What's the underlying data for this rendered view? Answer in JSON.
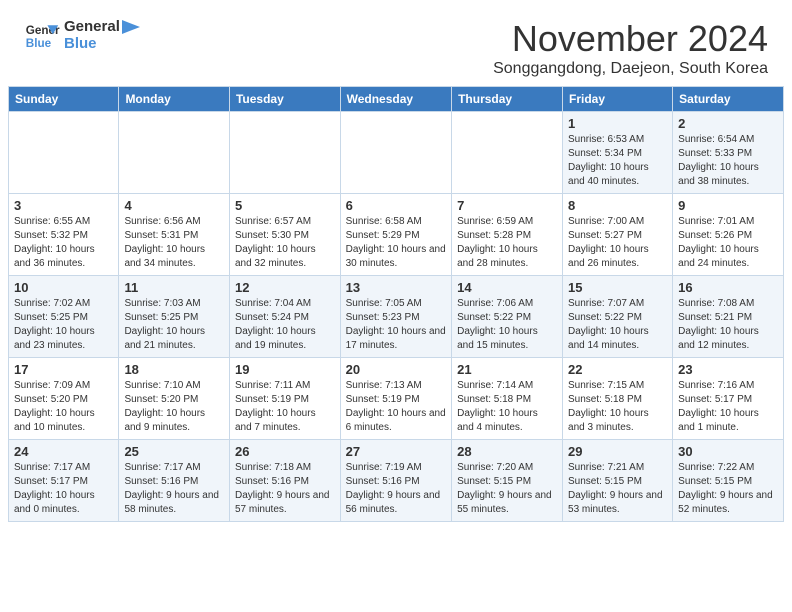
{
  "header": {
    "logo_line1": "General",
    "logo_line2": "Blue",
    "month": "November 2024",
    "location": "Songgangdong, Daejeon, South Korea"
  },
  "weekdays": [
    "Sunday",
    "Monday",
    "Tuesday",
    "Wednesday",
    "Thursday",
    "Friday",
    "Saturday"
  ],
  "weeks": [
    [
      {
        "day": "",
        "info": ""
      },
      {
        "day": "",
        "info": ""
      },
      {
        "day": "",
        "info": ""
      },
      {
        "day": "",
        "info": ""
      },
      {
        "day": "",
        "info": ""
      },
      {
        "day": "1",
        "info": "Sunrise: 6:53 AM\nSunset: 5:34 PM\nDaylight: 10 hours and 40 minutes."
      },
      {
        "day": "2",
        "info": "Sunrise: 6:54 AM\nSunset: 5:33 PM\nDaylight: 10 hours and 38 minutes."
      }
    ],
    [
      {
        "day": "3",
        "info": "Sunrise: 6:55 AM\nSunset: 5:32 PM\nDaylight: 10 hours and 36 minutes."
      },
      {
        "day": "4",
        "info": "Sunrise: 6:56 AM\nSunset: 5:31 PM\nDaylight: 10 hours and 34 minutes."
      },
      {
        "day": "5",
        "info": "Sunrise: 6:57 AM\nSunset: 5:30 PM\nDaylight: 10 hours and 32 minutes."
      },
      {
        "day": "6",
        "info": "Sunrise: 6:58 AM\nSunset: 5:29 PM\nDaylight: 10 hours and 30 minutes."
      },
      {
        "day": "7",
        "info": "Sunrise: 6:59 AM\nSunset: 5:28 PM\nDaylight: 10 hours and 28 minutes."
      },
      {
        "day": "8",
        "info": "Sunrise: 7:00 AM\nSunset: 5:27 PM\nDaylight: 10 hours and 26 minutes."
      },
      {
        "day": "9",
        "info": "Sunrise: 7:01 AM\nSunset: 5:26 PM\nDaylight: 10 hours and 24 minutes."
      }
    ],
    [
      {
        "day": "10",
        "info": "Sunrise: 7:02 AM\nSunset: 5:25 PM\nDaylight: 10 hours and 23 minutes."
      },
      {
        "day": "11",
        "info": "Sunrise: 7:03 AM\nSunset: 5:25 PM\nDaylight: 10 hours and 21 minutes."
      },
      {
        "day": "12",
        "info": "Sunrise: 7:04 AM\nSunset: 5:24 PM\nDaylight: 10 hours and 19 minutes."
      },
      {
        "day": "13",
        "info": "Sunrise: 7:05 AM\nSunset: 5:23 PM\nDaylight: 10 hours and 17 minutes."
      },
      {
        "day": "14",
        "info": "Sunrise: 7:06 AM\nSunset: 5:22 PM\nDaylight: 10 hours and 15 minutes."
      },
      {
        "day": "15",
        "info": "Sunrise: 7:07 AM\nSunset: 5:22 PM\nDaylight: 10 hours and 14 minutes."
      },
      {
        "day": "16",
        "info": "Sunrise: 7:08 AM\nSunset: 5:21 PM\nDaylight: 10 hours and 12 minutes."
      }
    ],
    [
      {
        "day": "17",
        "info": "Sunrise: 7:09 AM\nSunset: 5:20 PM\nDaylight: 10 hours and 10 minutes."
      },
      {
        "day": "18",
        "info": "Sunrise: 7:10 AM\nSunset: 5:20 PM\nDaylight: 10 hours and 9 minutes."
      },
      {
        "day": "19",
        "info": "Sunrise: 7:11 AM\nSunset: 5:19 PM\nDaylight: 10 hours and 7 minutes."
      },
      {
        "day": "20",
        "info": "Sunrise: 7:13 AM\nSunset: 5:19 PM\nDaylight: 10 hours and 6 minutes."
      },
      {
        "day": "21",
        "info": "Sunrise: 7:14 AM\nSunset: 5:18 PM\nDaylight: 10 hours and 4 minutes."
      },
      {
        "day": "22",
        "info": "Sunrise: 7:15 AM\nSunset: 5:18 PM\nDaylight: 10 hours and 3 minutes."
      },
      {
        "day": "23",
        "info": "Sunrise: 7:16 AM\nSunset: 5:17 PM\nDaylight: 10 hours and 1 minute."
      }
    ],
    [
      {
        "day": "24",
        "info": "Sunrise: 7:17 AM\nSunset: 5:17 PM\nDaylight: 10 hours and 0 minutes."
      },
      {
        "day": "25",
        "info": "Sunrise: 7:17 AM\nSunset: 5:16 PM\nDaylight: 9 hours and 58 minutes."
      },
      {
        "day": "26",
        "info": "Sunrise: 7:18 AM\nSunset: 5:16 PM\nDaylight: 9 hours and 57 minutes."
      },
      {
        "day": "27",
        "info": "Sunrise: 7:19 AM\nSunset: 5:16 PM\nDaylight: 9 hours and 56 minutes."
      },
      {
        "day": "28",
        "info": "Sunrise: 7:20 AM\nSunset: 5:15 PM\nDaylight: 9 hours and 55 minutes."
      },
      {
        "day": "29",
        "info": "Sunrise: 7:21 AM\nSunset: 5:15 PM\nDaylight: 9 hours and 53 minutes."
      },
      {
        "day": "30",
        "info": "Sunrise: 7:22 AM\nSunset: 5:15 PM\nDaylight: 9 hours and 52 minutes."
      }
    ]
  ]
}
